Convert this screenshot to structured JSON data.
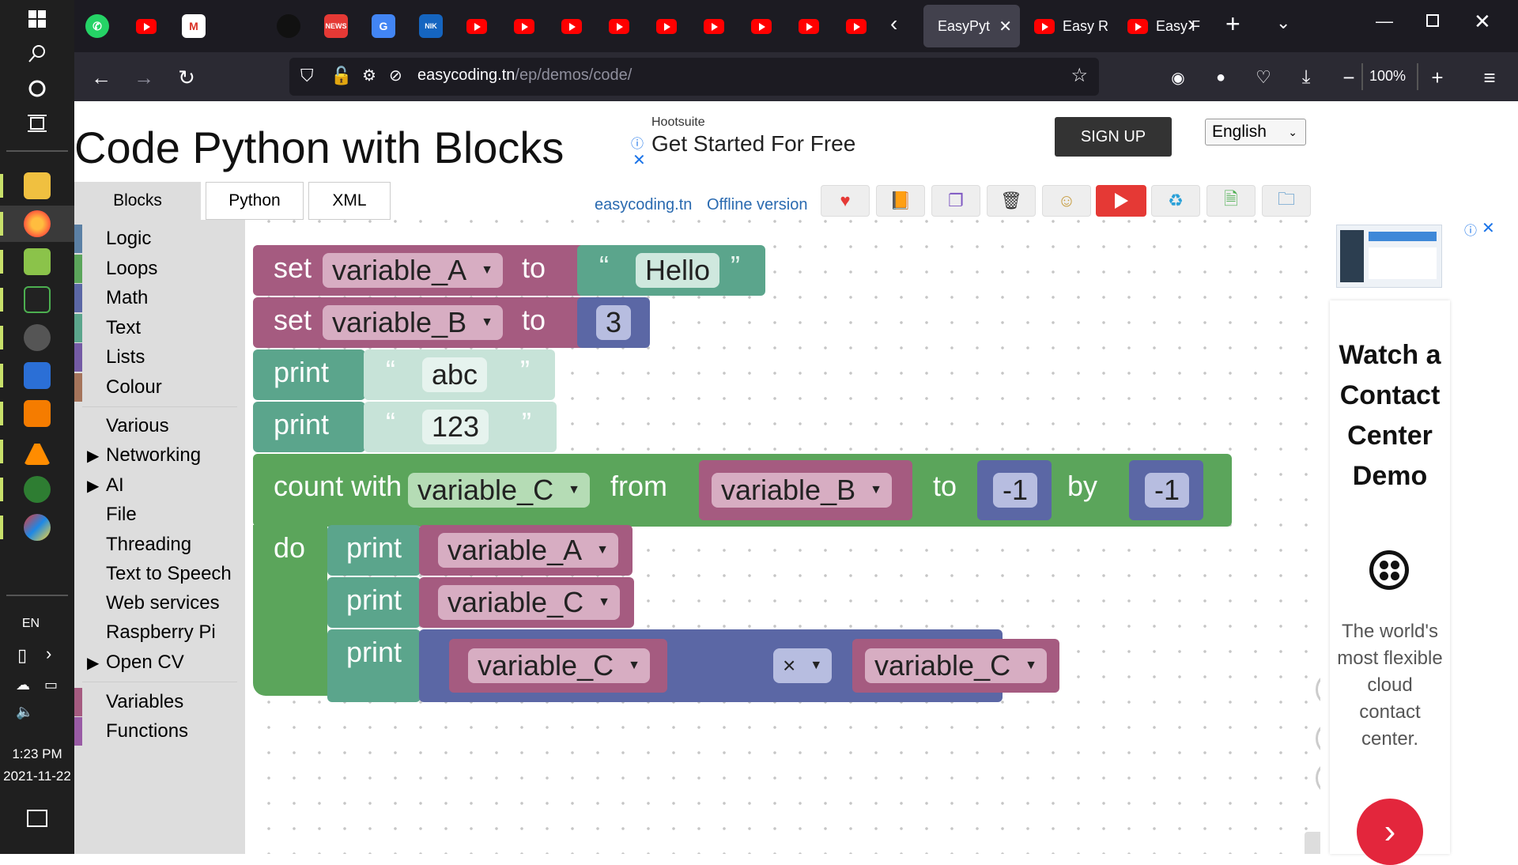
{
  "taskbar": {
    "language": "EN",
    "time": "1:23 PM",
    "date": "2021-11-22"
  },
  "browser": {
    "tabs": [
      {
        "label": "EasyPyt",
        "active": true
      },
      {
        "label": "Easy R",
        "active": false
      },
      {
        "label": "Easy F",
        "active": false
      }
    ],
    "url_domain": "easycoding.tn",
    "url_path": "/ep/demos/code/",
    "zoom": "100%"
  },
  "page": {
    "title": "Code Python with Blocks",
    "ad_top": {
      "brand": "Hootsuite",
      "headline": "Get Started For Free",
      "cta": "SIGN UP"
    },
    "language_select": "English",
    "tabs": [
      "Blocks",
      "Python",
      "XML"
    ],
    "links": {
      "site": "easycoding.tn",
      "offline": "Offline version"
    }
  },
  "toolbox": {
    "categories": [
      {
        "label": "Logic",
        "color": "#5b80a5"
      },
      {
        "label": "Loops",
        "color": "#5ba55b"
      },
      {
        "label": "Math",
        "color": "#5b67a5"
      },
      {
        "label": "Text",
        "color": "#5ba58c"
      },
      {
        "label": "Lists",
        "color": "#745ba5"
      },
      {
        "label": "Colour",
        "color": "#a5745b"
      },
      {
        "label": "Various",
        "color": ""
      },
      {
        "label": "Networking",
        "color": "",
        "expandable": true
      },
      {
        "label": "AI",
        "color": "",
        "expandable": true
      },
      {
        "label": "File",
        "color": ""
      },
      {
        "label": "Threading",
        "color": ""
      },
      {
        "label": "Text to Speech",
        "color": ""
      },
      {
        "label": "Web services",
        "color": ""
      },
      {
        "label": "Raspberry Pi",
        "color": ""
      },
      {
        "label": "Open CV",
        "color": "",
        "expandable": true
      },
      {
        "label": "Variables",
        "color": "#a55b80"
      },
      {
        "label": "Functions",
        "color": "#995ba5"
      }
    ]
  },
  "blocks": {
    "set1": {
      "kw": "set",
      "var": "variable_A",
      "to": "to",
      "q1": "“",
      "value": "Hello",
      "q2": "”"
    },
    "set2": {
      "kw": "set",
      "var": "variable_B",
      "to": "to",
      "value": "3"
    },
    "print1": {
      "kw": "print",
      "q1": "“",
      "value": "abc",
      "q2": "”"
    },
    "print2": {
      "kw": "print",
      "q1": "“",
      "value": "123",
      "q2": "”"
    },
    "loop": {
      "kw": "count with",
      "var": "variable_C",
      "from": "from",
      "from_val": "variable_B",
      "to": "to",
      "to_val": "-1",
      "by": "by",
      "by_val": "-1",
      "do": "do"
    },
    "inner1": {
      "kw": "print",
      "var": "variable_A"
    },
    "inner2": {
      "kw": "print",
      "var": "variable_C"
    },
    "inner3": {
      "kw": "print",
      "left": "variable_C",
      "op": "×",
      "right": "variable_C"
    }
  },
  "ad_right": {
    "heading": "Watch a Contact Center Demo",
    "body": "The world's most flexible cloud contact center."
  },
  "colors": {
    "variables": "#a55b80",
    "text": "#5ba58c",
    "loops": "#5ba55b",
    "math": "#5b67a5"
  }
}
